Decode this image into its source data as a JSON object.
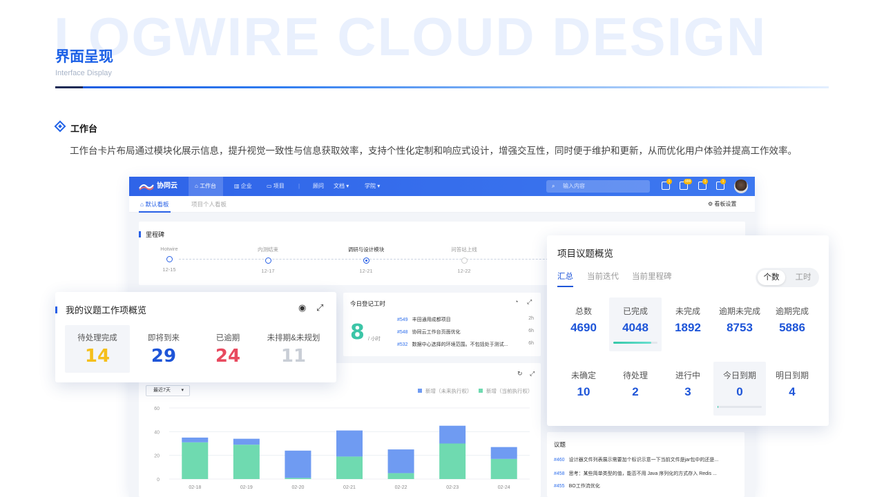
{
  "hero_background": "LOGWIRE CLOUD DESIGN",
  "title": "界面呈现",
  "subtitle": "Interface Display",
  "section": {
    "title": "工作台",
    "description": "工作台卡片布局通过模块化展示信息，提升视觉一致性与信息获取效率，支持个性化定制和响应式设计，增强交互性，同时便于维护和更新，从而优化用户体验并提高工作效率。"
  },
  "app": {
    "logo_text": "协同云",
    "nav": {
      "home": "工作台",
      "enterprise": "企业",
      "project": "项目",
      "consult": "顾问",
      "docs": "文档",
      "academy": "学院"
    },
    "search_placeholder": "输入内容",
    "badges": {
      "b1": "1",
      "b2": "999",
      "b3": "1",
      "b4": "1"
    },
    "tabs": {
      "default": "默认看板",
      "personal": "项目个人看板",
      "settings": "看板设置"
    },
    "milestone": {
      "title": "里程碑",
      "items": [
        {
          "name": "Hotwire",
          "date": "12-15"
        },
        {
          "name": "内测结束",
          "date": "12-17"
        },
        {
          "name": "调研与设计模块",
          "date": "12-21"
        },
        {
          "name": "问答站上线",
          "date": "12-22"
        }
      ]
    },
    "worklog": {
      "title": "今日登记工时",
      "hours": "8",
      "unit": "/ 小时",
      "rows": [
        {
          "id": "#549",
          "text": "丰田通用成都项目",
          "h": "2h"
        },
        {
          "id": "#548",
          "text": "协同云工作台页面优化",
          "h": "6h"
        },
        {
          "id": "#532",
          "text": "数据中心选择的环境范围。不包括处于测试...",
          "h": "6h"
        }
      ]
    },
    "chart": {
      "range": "最近7天",
      "legend1": "新增（未来执行权）",
      "legend2": "新增（当前执行权）"
    },
    "issues": {
      "title": "议题",
      "rows": [
        {
          "id": "#460",
          "text": "设计器文件列表展示需要加个标识示意一下当前文件是jar包中的还是..."
        },
        {
          "id": "#458",
          "text": "思考：某些简单类型的值，能否不用 Java 序列化的方式存入 Redis ..."
        },
        {
          "id": "#455",
          "text": "BO工作流优化"
        }
      ]
    }
  },
  "my_card": {
    "title": "我的议题工作项概览",
    "stats": [
      {
        "label": "待处理完成",
        "value": "14"
      },
      {
        "label": "即将到来",
        "value": "29"
      },
      {
        "label": "已逾期",
        "value": "24"
      },
      {
        "label": "未排期&未规划",
        "value": "11"
      }
    ],
    "colors": [
      "#f5bf1b",
      "#1e55d8",
      "#e84a5f",
      "#c9ced6"
    ]
  },
  "proj_card": {
    "title": "项目议题概览",
    "tabs": [
      "汇总",
      "当前迭代",
      "当前里程碑"
    ],
    "toggle": [
      "个数",
      "工时"
    ],
    "stats": [
      {
        "label": "总数",
        "value": "4690"
      },
      {
        "label": "已完成",
        "value": "4048"
      },
      {
        "label": "未完成",
        "value": "1892"
      },
      {
        "label": "逾期未完成",
        "value": "8753"
      },
      {
        "label": "逾期完成",
        "value": "5886"
      },
      {
        "label": "未确定",
        "value": "10"
      },
      {
        "label": "待处理",
        "value": "2"
      },
      {
        "label": "进行中",
        "value": "3"
      },
      {
        "label": "今日到期",
        "value": "0"
      },
      {
        "label": "明日到期",
        "value": "4"
      }
    ],
    "done_progress": 0.86,
    "today_progress": 0.02
  },
  "chart_data": {
    "type": "bar",
    "stacked": true,
    "categories": [
      "02-18",
      "02-19",
      "02-20",
      "02-21",
      "02-22",
      "02-23",
      "02-24"
    ],
    "series": [
      {
        "name": "新增（当前执行权）",
        "color": "#6fdab0",
        "values": [
          31,
          29,
          1,
          19,
          5,
          30,
          17
        ]
      },
      {
        "name": "新增（未来执行权）",
        "color": "#6f9bf2",
        "values": [
          4,
          5,
          23,
          22,
          20,
          15,
          10
        ]
      }
    ],
    "yticks": [
      0,
      20,
      40,
      60
    ],
    "ylim": [
      0,
      60
    ],
    "grid": true,
    "legend": "top-right"
  }
}
